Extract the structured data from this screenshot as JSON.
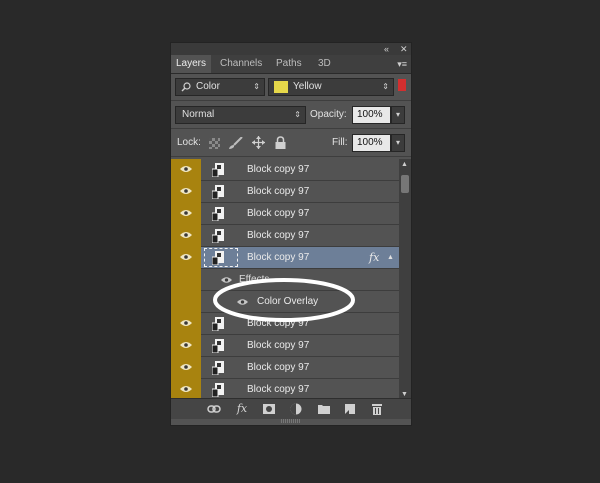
{
  "window": {
    "collapse_icon": "«",
    "close_icon": "✕"
  },
  "tabs": [
    {
      "label": "Layers",
      "active": true
    },
    {
      "label": "Channels",
      "active": false
    },
    {
      "label": "Paths",
      "active": false
    },
    {
      "label": "3D",
      "active": false
    }
  ],
  "panel_menu_icon": "▾≡",
  "filter": {
    "kind_value": "Color",
    "color_value": "Yellow",
    "swatch_color": "#e6d84a",
    "toggle_color": "#d32f2f"
  },
  "blend": {
    "mode_value": "Normal",
    "opacity_label": "Opacity:",
    "opacity_value": "100%"
  },
  "lock": {
    "label": "Lock:",
    "fill_label": "Fill:",
    "fill_value": "100%"
  },
  "layer_highlight_color": "#a8830f",
  "layers": [
    {
      "name": "Block copy 97",
      "selected": false
    },
    {
      "name": "Block copy 97",
      "selected": false
    },
    {
      "name": "Block copy 97",
      "selected": false
    },
    {
      "name": "Block copy 97",
      "selected": false
    },
    {
      "name": "Block copy 97",
      "selected": true,
      "fx": "fx"
    },
    {
      "name": "Block copy 97",
      "selected": false
    },
    {
      "name": "Block copy 97",
      "selected": false
    },
    {
      "name": "Block copy 97",
      "selected": false
    },
    {
      "name": "Block copy 97",
      "selected": false
    }
  ],
  "effects": {
    "label": "Effects",
    "item": "Color Overlay"
  },
  "footer_icons": [
    "link-icon",
    "fx-icon",
    "mask-icon",
    "adjustment-icon",
    "folder-icon",
    "new-layer-icon",
    "trash-icon"
  ],
  "footer_fx_label": "fx"
}
